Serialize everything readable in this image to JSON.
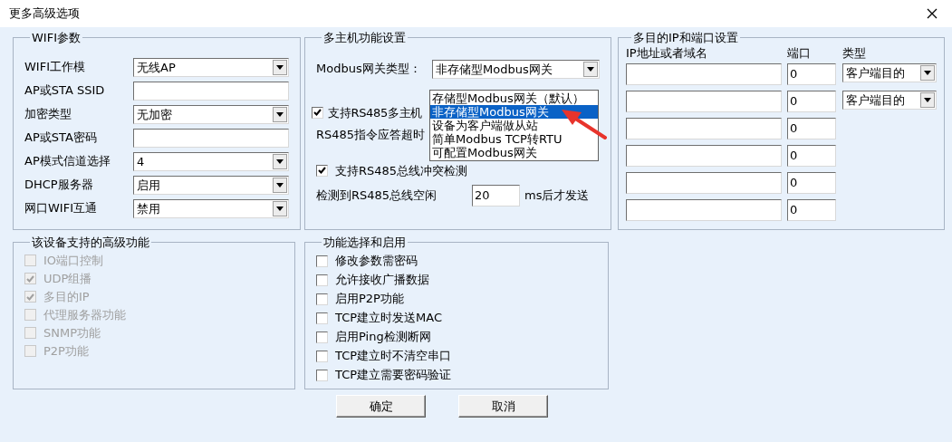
{
  "window": {
    "title": "更多高级选项"
  },
  "wifi_group": {
    "title": "WIFI参数",
    "rows": [
      {
        "label": "WIFI工作模",
        "kind": "select",
        "value": "无线AP"
      },
      {
        "label": "AP或STA SSID",
        "kind": "input"
      },
      {
        "label": "加密类型",
        "kind": "select",
        "value": "无加密"
      },
      {
        "label": "AP或STA密码",
        "kind": "input"
      },
      {
        "label": "AP模式信道选择",
        "kind": "select",
        "value": "4"
      },
      {
        "label": "DHCP服务器",
        "kind": "select",
        "value": "启用"
      },
      {
        "label": "网口WIFI互通",
        "kind": "select",
        "value": "禁用"
      }
    ]
  },
  "multi_host_group": {
    "title": "多主机功能设置",
    "gateway_label": "Modbus网关类型：",
    "gateway_value": "非存储型Modbus网关",
    "gateway_options": [
      {
        "label": "存储型Modbus网关（默认）",
        "selected": false
      },
      {
        "label": "非存储型Modbus网关",
        "selected": true
      },
      {
        "label": "设备为客户端做从站",
        "selected": false
      },
      {
        "label": "简单Modbus TCP转RTU",
        "selected": false
      },
      {
        "label": "可配置Modbus网关",
        "selected": false
      }
    ],
    "multi_master": {
      "label": "支持RS485多主机",
      "checked": true
    },
    "timeout_label": "RS485指令应答超时",
    "collision": {
      "label": "支持RS485总线冲突检测",
      "checked": true
    },
    "idle_label": "检测到RS485总线空闲",
    "idle_value": "20",
    "idle_unit": "ms后才发送"
  },
  "ip_group": {
    "title": "多目的IP和端口设置",
    "columns": [
      "IP地址或者域名",
      "端口",
      "类型"
    ],
    "rows": [
      {
        "port": "0",
        "type": "客户端目的"
      },
      {
        "port": "0",
        "type": "客户端目的"
      },
      {
        "port": "0"
      },
      {
        "port": "0"
      },
      {
        "port": "0"
      },
      {
        "port": "0"
      }
    ]
  },
  "advanced_group": {
    "title": "该设备支持的高级功能",
    "items": [
      {
        "label": "IO端口控制",
        "checked": false,
        "disabled": true
      },
      {
        "label": "UDP组播",
        "checked": true,
        "disabled": true
      },
      {
        "label": "多目的IP",
        "checked": true,
        "disabled": true
      },
      {
        "label": "代理服务器功能",
        "checked": false,
        "disabled": true
      },
      {
        "label": "SNMP功能",
        "checked": false,
        "disabled": true
      },
      {
        "label": "P2P功能",
        "checked": false,
        "disabled": true
      }
    ]
  },
  "feature_group": {
    "title": "功能选择和启用",
    "items": [
      {
        "label": "修改参数需密码",
        "checked": false
      },
      {
        "label": "允许接收广播数据",
        "checked": false
      },
      {
        "label": "启用P2P功能",
        "checked": false
      },
      {
        "label": "TCP建立时发送MAC",
        "checked": false
      },
      {
        "label": "启用Ping检测断网",
        "checked": false
      },
      {
        "label": "TCP建立时不清空串口",
        "checked": false
      },
      {
        "label": "TCP建立需要密码验证",
        "checked": false
      }
    ]
  },
  "buttons": [
    "确定",
    "取消"
  ]
}
